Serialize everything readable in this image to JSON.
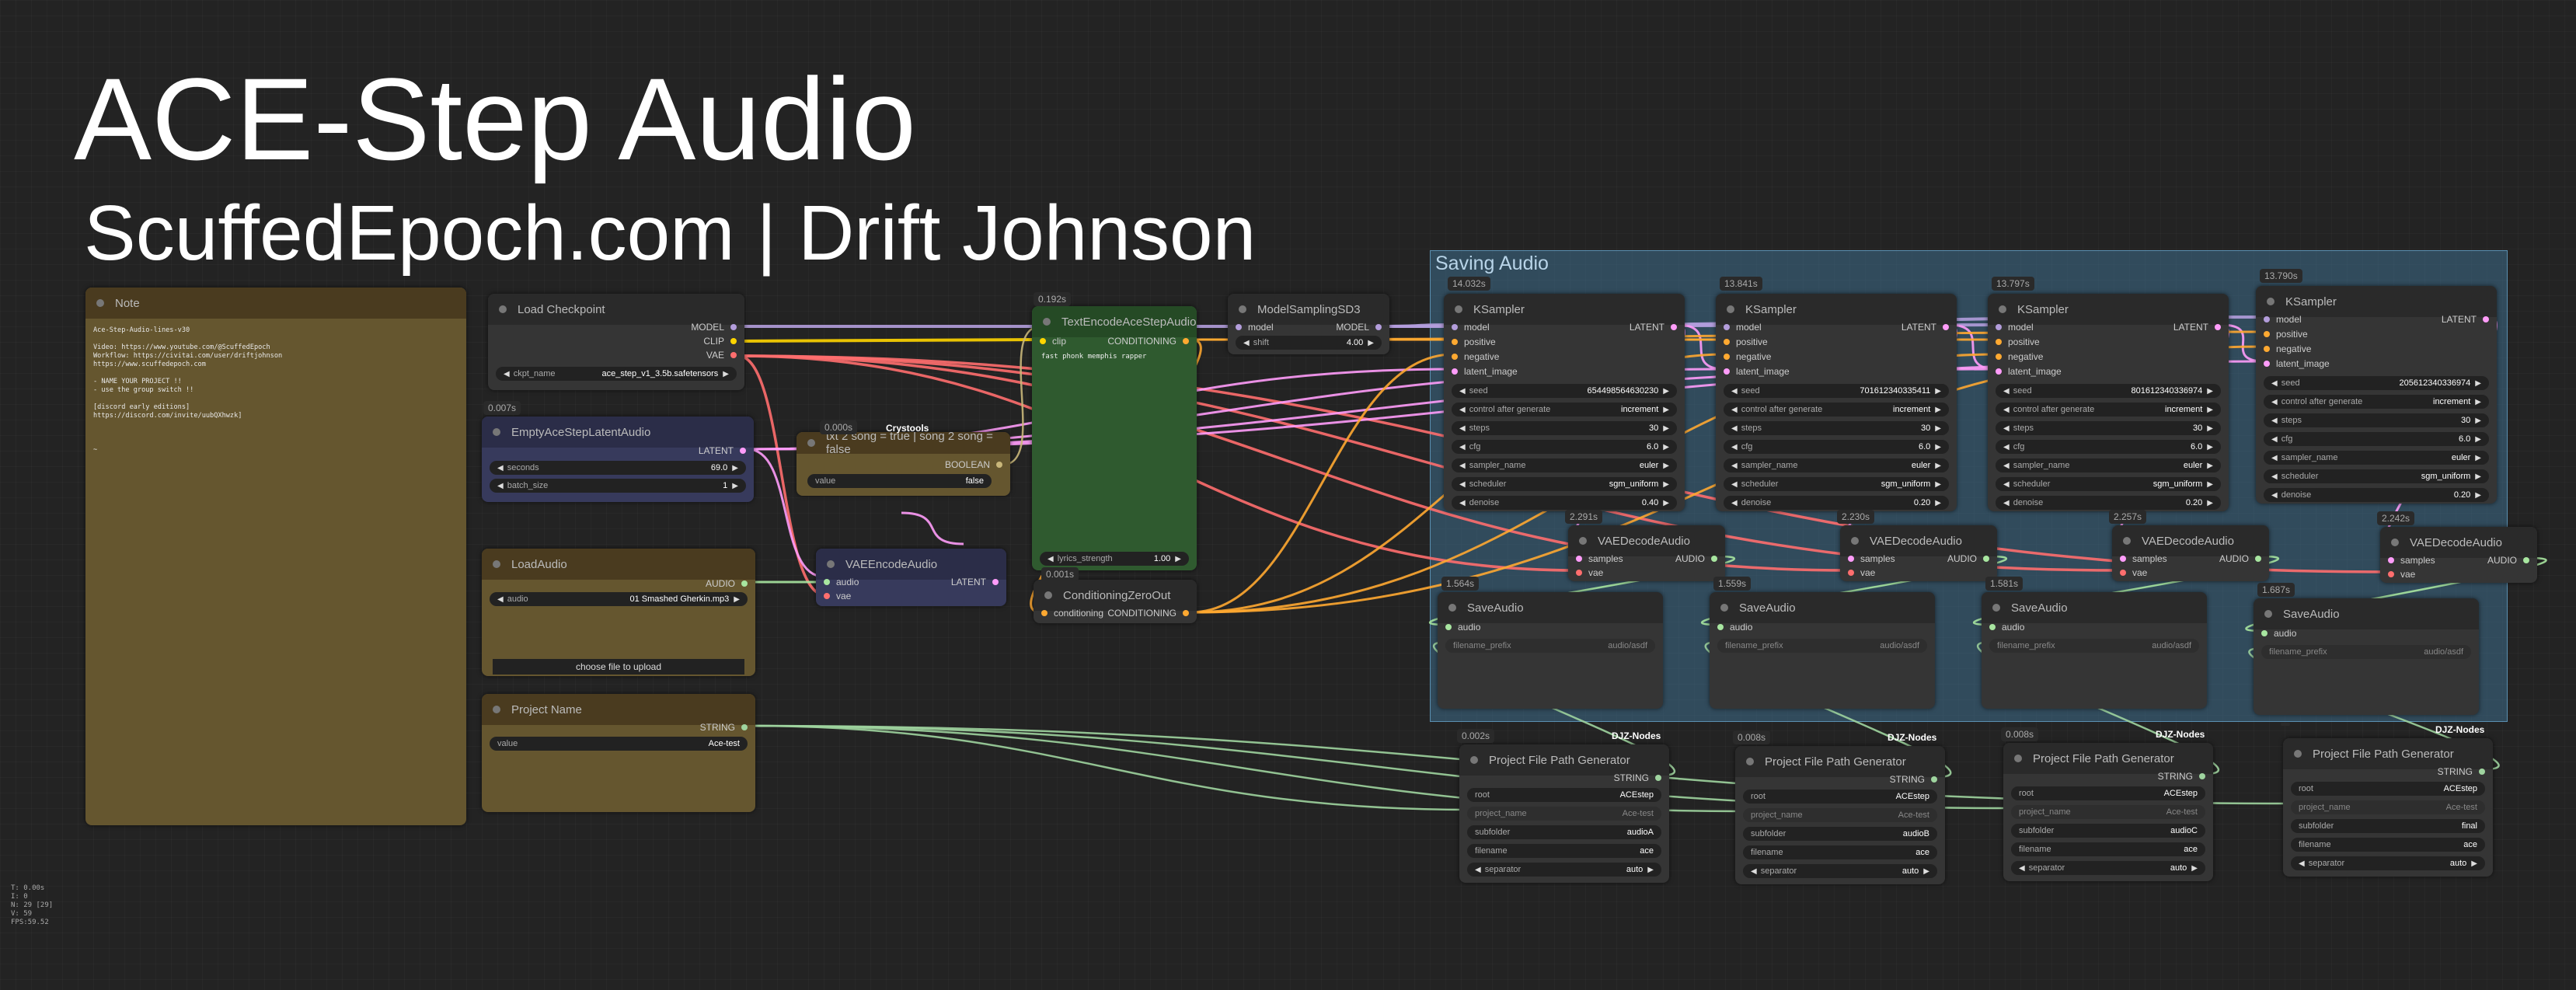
{
  "title": "ACE-Step Audio",
  "subtitle": "ScuffedEpoch.com | Drift Johnson",
  "group": {
    "title": "Saving Audio"
  },
  "note": {
    "title": "Note",
    "lines": [
      "Ace-Step-Audio-lines-v30",
      "",
      "Video: https://www.youtube.com/@ScuffedEpoch",
      "Workflow: https://civitai.com/user/driftjohnson",
      "https://www.scuffedepoch.com",
      "",
      "- NAME YOUR PROJECT !!",
      "- use the group switch !!",
      "",
      "[discord early editions]",
      "https://discord.com/invite/uubQXhwzk]",
      "",
      "",
      "",
      "~"
    ]
  },
  "checkpoint": {
    "title": "Load Checkpoint",
    "out_model": "MODEL",
    "out_clip": "CLIP",
    "out_vae": "VAE",
    "ckpt_label": "ckpt_name",
    "ckpt_value": "ace_step_v1_3.5b.safetensors"
  },
  "empty_latent": {
    "badge": "0.007s",
    "title": "EmptyAceStepLatentAudio",
    "out": "LATENT",
    "seconds_label": "seconds",
    "seconds_value": "69.0",
    "batch_label": "batch_size",
    "batch_value": "1"
  },
  "switch": {
    "badge": "0.000s",
    "tag": "Crystools",
    "title": "txt 2 song = true | song 2 song = false",
    "out": "BOOLEAN",
    "value_label": "value",
    "value": "false"
  },
  "text_encode": {
    "badge": "0.192s",
    "title": "TextEncodeAceStepAudio",
    "in_clip": "clip",
    "out": "CONDITIONING",
    "prompt": "fast phonk memphis rapper",
    "lyrics_label": "lyrics_strength",
    "lyrics_value": "1.00"
  },
  "model_sampling": {
    "title": "ModelSamplingSD3",
    "in_model": "model",
    "out_model": "MODEL",
    "shift_label": "shift",
    "shift_value": "4.00"
  },
  "load_audio": {
    "title": "LoadAudio",
    "out": "AUDIO",
    "audio_label": "audio",
    "audio_value": "01 Smashed Gherkin.mp3",
    "upload": "choose file to upload"
  },
  "vae_encode": {
    "title": "VAEEncodeAudio",
    "in_audio": "audio",
    "in_vae": "vae",
    "out": "LATENT"
  },
  "cond_zero": {
    "badge": "0.001s",
    "title": "ConditioningZeroOut",
    "in": "conditioning",
    "out": "CONDITIONING"
  },
  "project_name": {
    "title": "Project Name",
    "out": "STRING",
    "value_label": "value",
    "value": "Ace-test"
  },
  "ksampler_common": {
    "title": "KSampler",
    "in_model": "model",
    "in_pos": "positive",
    "in_neg": "negative",
    "in_latent": "latent_image",
    "out": "LATENT",
    "seed_label": "seed",
    "control_label": "control after generate",
    "control_value": "increment",
    "steps_label": "steps",
    "steps_value": "30",
    "cfg_label": "cfg",
    "cfg_value": "6.0",
    "sampler_label": "sampler_name",
    "sampler_value": "euler",
    "scheduler_label": "scheduler",
    "scheduler_value": "sgm_uniform",
    "denoise_label": "denoise"
  },
  "ksamplers": [
    {
      "badge": "14.032s",
      "seed": "654498564630230",
      "denoise": "0.40"
    },
    {
      "badge": "13.841s",
      "seed": "701612340335411",
      "denoise": "0.20"
    },
    {
      "badge": "13.797s",
      "seed": "801612340336974",
      "denoise": "0.20"
    },
    {
      "badge": "13.790s",
      "seed": "205612340336974",
      "denoise": "0.20"
    }
  ],
  "vae_decode_common": {
    "title": "VAEDecodeAudio",
    "in_samples": "samples",
    "in_vae": "vae",
    "out": "AUDIO"
  },
  "vae_decodes": [
    {
      "badge": "2.291s"
    },
    {
      "badge": "2.230s"
    },
    {
      "badge": "2.257s"
    },
    {
      "badge": "2.242s"
    }
  ],
  "save_common": {
    "title": "SaveAudio",
    "in_audio": "audio",
    "prefix_label": "filename_prefix",
    "prefix_value": "audio/asdf"
  },
  "saves": [
    {
      "badge": "1.564s"
    },
    {
      "badge": "1.559s"
    },
    {
      "badge": "1.581s"
    },
    {
      "badge": "1.687s"
    }
  ],
  "pfpg_common": {
    "title": "Project File Path Generator",
    "tag": "DJZ-Nodes",
    "out": "STRING",
    "root_label": "root",
    "root_value": "ACEstep",
    "project_label": "project_name",
    "project_value": "Ace-test",
    "subfolder_label": "subfolder",
    "filename_label": "filename",
    "filename_value": "ace",
    "separator_label": "separator",
    "separator_value": "auto"
  },
  "pfpgs": [
    {
      "badge": "0.002s",
      "subfolder": "audioA"
    },
    {
      "badge": "0.008s",
      "subfolder": "audioB"
    },
    {
      "badge": "0.008s",
      "subfolder": "audioC"
    },
    {
      "badge": "",
      "subfolder": "final"
    }
  ],
  "stats": {
    "lines": [
      "T: 0.00s",
      "I: 0",
      "N: 29 [29]",
      "V: 59",
      "FPS:59.52"
    ]
  },
  "colors": {
    "model": "#b39ddb",
    "clip": "#ffd500",
    "vae": "#ff6e6e",
    "latent": "#ff9cf9",
    "conditioning": "#ffa931",
    "audio": "#a8e6a0",
    "string": "#9fd49f",
    "boolean": "#c9b77a",
    "group": "#3e6e8c"
  }
}
